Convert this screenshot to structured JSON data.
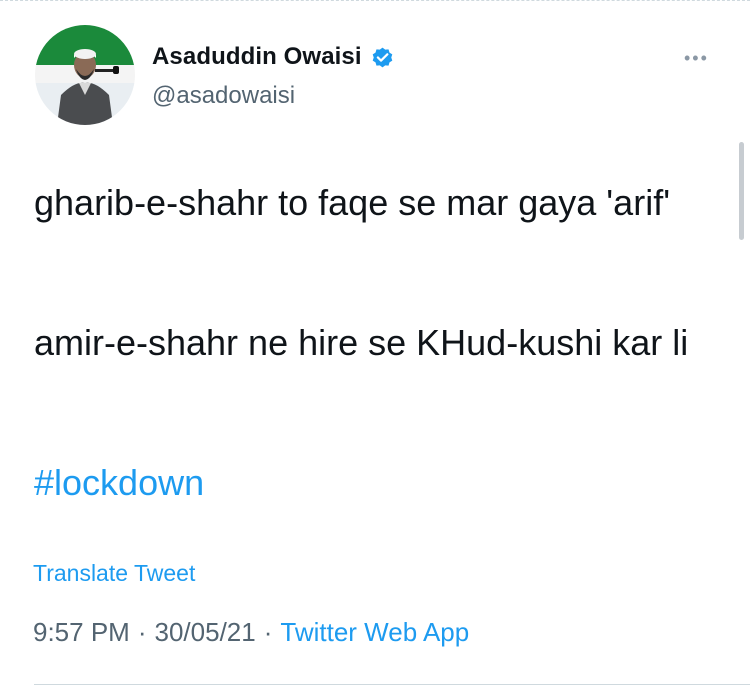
{
  "tweet": {
    "author": {
      "display_name": "Asaduddin Owaisi",
      "handle": "@asadowaisi",
      "verified_icon": "verified-badge-icon"
    },
    "more_menu_icon": "more-dots-icon",
    "body": {
      "paragraph_1": "gharib-e-shahr to faqe se mar gaya 'arif'",
      "paragraph_2": "amir-e-shahr ne hire se KHud-kushi kar li",
      "hashtag": "#lockdown"
    },
    "translate_label": "Translate Tweet",
    "meta": {
      "time": "9:57 PM",
      "separator": "·",
      "date": "30/05/21",
      "source": "Twitter Web App"
    }
  },
  "colors": {
    "link": "#1d9bf0",
    "text_primary": "#0f1419",
    "text_secondary": "#536471",
    "avatar_green": "#1b8a3b"
  }
}
